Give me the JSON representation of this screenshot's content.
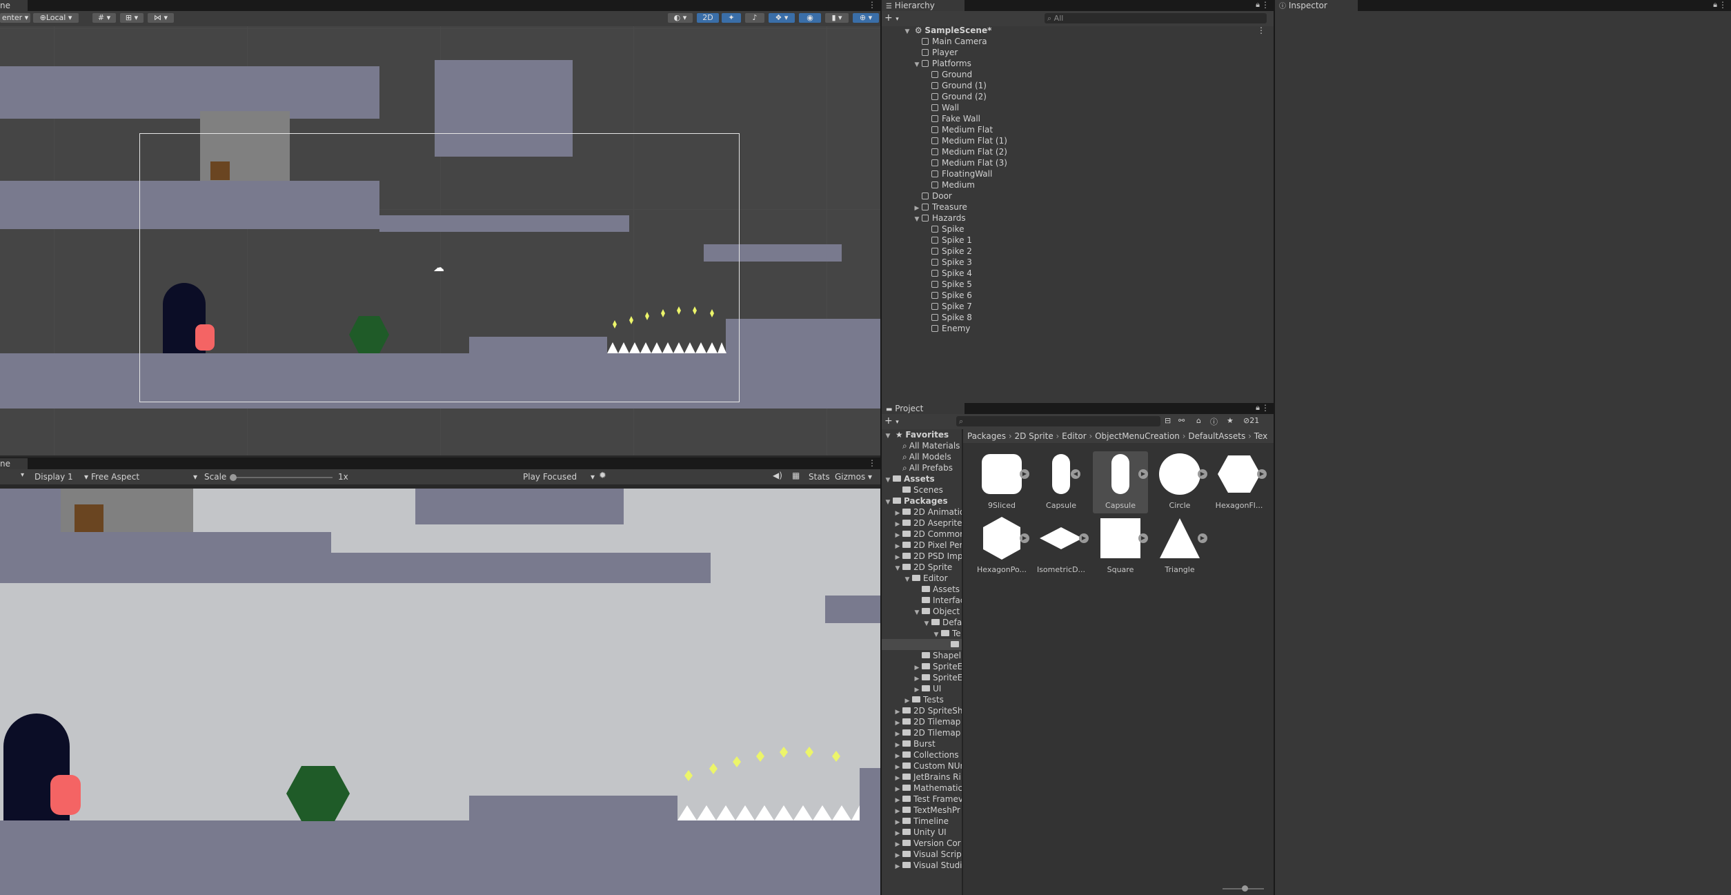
{
  "scene_view": {
    "tab_fragment": "ne",
    "pivot_label": "enter",
    "space_label": "Local",
    "mode_2d_label": "2D"
  },
  "game_view": {
    "tab_fragment": "ne",
    "display_label": "Display 1",
    "aspect_label": "Free Aspect",
    "scale_label": "Scale",
    "scale_value": "1x",
    "play_mode_label": "Play Focused",
    "stats_label": "Stats",
    "gizmos_label": "Gizmos"
  },
  "hierarchy": {
    "tab_label": "Hierarchy",
    "search_placeholder": "All",
    "scene_name": "SampleScene*",
    "items": [
      {
        "label": "Main Camera",
        "depth": 1
      },
      {
        "label": "Player",
        "depth": 1
      },
      {
        "label": "Platforms",
        "depth": 1,
        "expanded": true
      },
      {
        "label": "Ground",
        "depth": 2
      },
      {
        "label": "Ground (1)",
        "depth": 2
      },
      {
        "label": "Ground (2)",
        "depth": 2
      },
      {
        "label": "Wall",
        "depth": 2
      },
      {
        "label": "Fake Wall",
        "depth": 2
      },
      {
        "label": "Medium Flat",
        "depth": 2
      },
      {
        "label": "Medium Flat (1)",
        "depth": 2
      },
      {
        "label": "Medium Flat (2)",
        "depth": 2
      },
      {
        "label": "Medium Flat (3)",
        "depth": 2
      },
      {
        "label": "FloatingWall",
        "depth": 2
      },
      {
        "label": "Medium",
        "depth": 2
      },
      {
        "label": "Door",
        "depth": 1
      },
      {
        "label": "Treasure",
        "depth": 1,
        "expanded": false
      },
      {
        "label": "Hazards",
        "depth": 1,
        "expanded": true
      },
      {
        "label": "Spike",
        "depth": 2
      },
      {
        "label": "Spike 1",
        "depth": 2
      },
      {
        "label": "Spike 2",
        "depth": 2
      },
      {
        "label": "Spike 3",
        "depth": 2
      },
      {
        "label": "Spike 4",
        "depth": 2
      },
      {
        "label": "Spike 5",
        "depth": 2
      },
      {
        "label": "Spike 6",
        "depth": 2
      },
      {
        "label": "Spike 7",
        "depth": 2
      },
      {
        "label": "Spike 8",
        "depth": 2
      },
      {
        "label": "Enemy",
        "depth": 2
      }
    ]
  },
  "inspector": {
    "tab_label": "Inspector"
  },
  "project": {
    "tab_label": "Project",
    "hidden_count": "21",
    "breadcrumb": [
      "Packages",
      "2D Sprite",
      "Editor",
      "ObjectMenuCreation",
      "DefaultAssets",
      "Tex"
    ],
    "favorites": {
      "label": "Favorites",
      "items": [
        "All Materials",
        "All Models",
        "All Prefabs"
      ]
    },
    "tree": [
      {
        "label": "Assets",
        "depth": 0,
        "bold": true
      },
      {
        "label": "Scenes",
        "depth": 1
      },
      {
        "label": "Packages",
        "depth": 0,
        "bold": true
      },
      {
        "label": "2D Animatio",
        "depth": 1
      },
      {
        "label": "2D Aseprite",
        "depth": 1
      },
      {
        "label": "2D Commor",
        "depth": 1
      },
      {
        "label": "2D Pixel Per",
        "depth": 1
      },
      {
        "label": "2D PSD Imp",
        "depth": 1
      },
      {
        "label": "2D Sprite",
        "depth": 1
      },
      {
        "label": "Editor",
        "depth": 2
      },
      {
        "label": "Assets",
        "depth": 3
      },
      {
        "label": "Interfac",
        "depth": 3
      },
      {
        "label": "Object",
        "depth": 3
      },
      {
        "label": "Defa",
        "depth": 4
      },
      {
        "label": "Te",
        "depth": 5
      },
      {
        "label": "",
        "depth": 6
      },
      {
        "label": "Shapel",
        "depth": 3
      },
      {
        "label": "SpriteE",
        "depth": 3
      },
      {
        "label": "SpriteE",
        "depth": 3
      },
      {
        "label": "UI",
        "depth": 3
      },
      {
        "label": "Tests",
        "depth": 2
      },
      {
        "label": "2D SpriteSh",
        "depth": 1
      },
      {
        "label": "2D Tilemap",
        "depth": 1
      },
      {
        "label": "2D Tilemap",
        "depth": 1
      },
      {
        "label": "Burst",
        "depth": 1
      },
      {
        "label": "Collections",
        "depth": 1
      },
      {
        "label": "Custom NUr",
        "depth": 1
      },
      {
        "label": "JetBrains Ri",
        "depth": 1
      },
      {
        "label": "Mathematic",
        "depth": 1
      },
      {
        "label": "Test Framev",
        "depth": 1
      },
      {
        "label": "TextMeshPr",
        "depth": 1
      },
      {
        "label": "Timeline",
        "depth": 1
      },
      {
        "label": "Unity UI",
        "depth": 1
      },
      {
        "label": "Version Cor",
        "depth": 1
      },
      {
        "label": "Visual Scrip",
        "depth": 1
      },
      {
        "label": "Visual Studi",
        "depth": 1
      }
    ],
    "assets": [
      {
        "label": "9Sliced",
        "shape": "rounded-square"
      },
      {
        "label": "Capsule",
        "shape": "capsule"
      },
      {
        "label": "Capsule",
        "shape": "capsule-selected"
      },
      {
        "label": "Circle",
        "shape": "circle"
      },
      {
        "label": "HexagonFl...",
        "shape": "hexagon-flat"
      },
      {
        "label": "HexagonPo...",
        "shape": "hexagon-pointy"
      },
      {
        "label": "IsometricD...",
        "shape": "diamond"
      },
      {
        "label": "Square",
        "shape": "square"
      },
      {
        "label": "Triangle",
        "shape": "triangle"
      }
    ]
  },
  "colors": {
    "scene_bg": "#454545",
    "platform": "#797a8e",
    "game_bg": "#c3c5c8",
    "door": "#0b0d26",
    "player": "#f46464",
    "enemy": "#1f5b28",
    "treasure": "#6a4521",
    "gem": "#ecf56a",
    "spikes": "#ffffff",
    "accent_blue": "#3a6ea8"
  }
}
